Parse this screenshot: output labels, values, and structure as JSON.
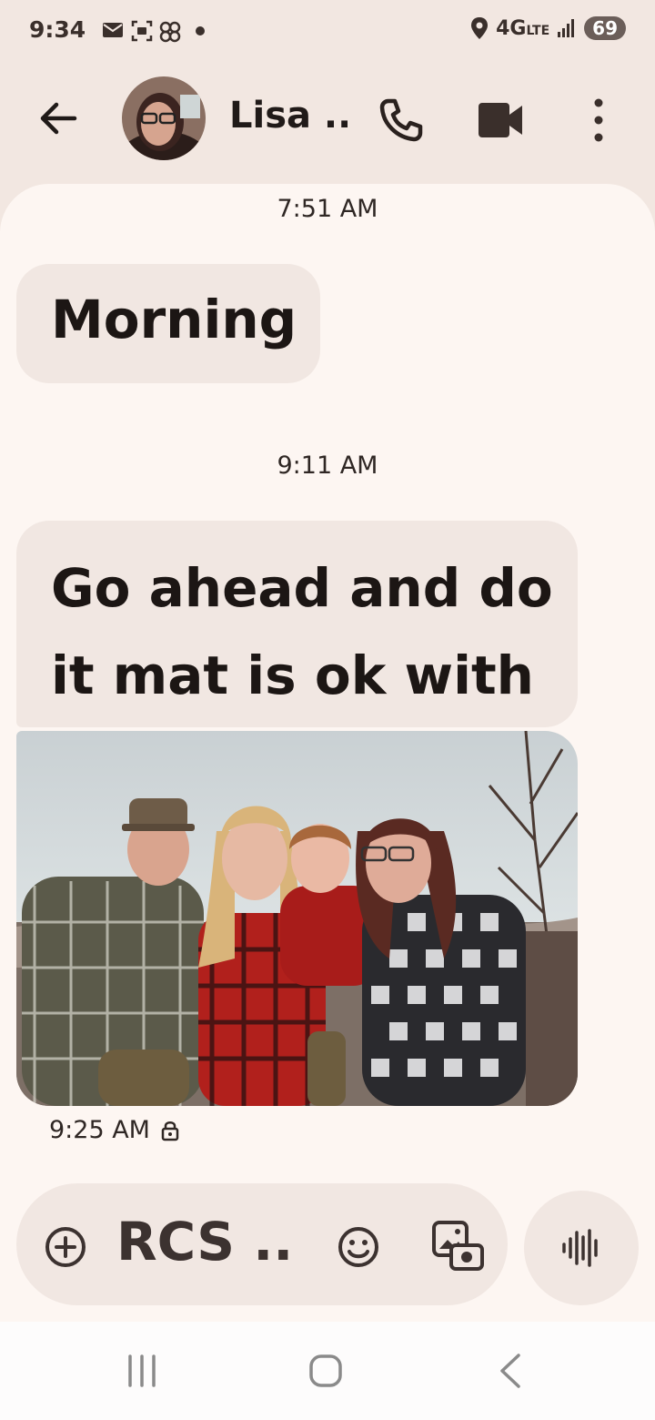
{
  "status_bar": {
    "time": "9:34",
    "network": "4G",
    "network_sub": "LTE",
    "battery": "69",
    "icons": [
      "mail-icon",
      "screenshot-icon",
      "pinwheel-icon",
      "dot-icon",
      "location-icon",
      "signal-icon"
    ]
  },
  "header": {
    "contact_name": "Lisa ...",
    "icons": [
      "back-arrow-icon",
      "phone-icon",
      "video-icon",
      "more-vert-icon"
    ]
  },
  "conversation": {
    "messages": [
      {
        "time": "7:51 AM",
        "text": "Morning"
      },
      {
        "time": "9:11 AM",
        "text_lines": [
          "Go ahead and do",
          "it mat is ok with it"
        ],
        "attachment": "family-photo"
      }
    ],
    "sent_time": "9:25 AM",
    "sent_icon": "lock-icon"
  },
  "compose": {
    "placeholder": "RCS ...",
    "icons": [
      "add-circle-icon",
      "emoji-icon",
      "gallery-icon",
      "voice-wave-icon"
    ]
  },
  "colors": {
    "background": "#f2e7e1",
    "panel": "#fdf6f2",
    "bubble": "#f1e7e2",
    "text": "#201a18"
  }
}
